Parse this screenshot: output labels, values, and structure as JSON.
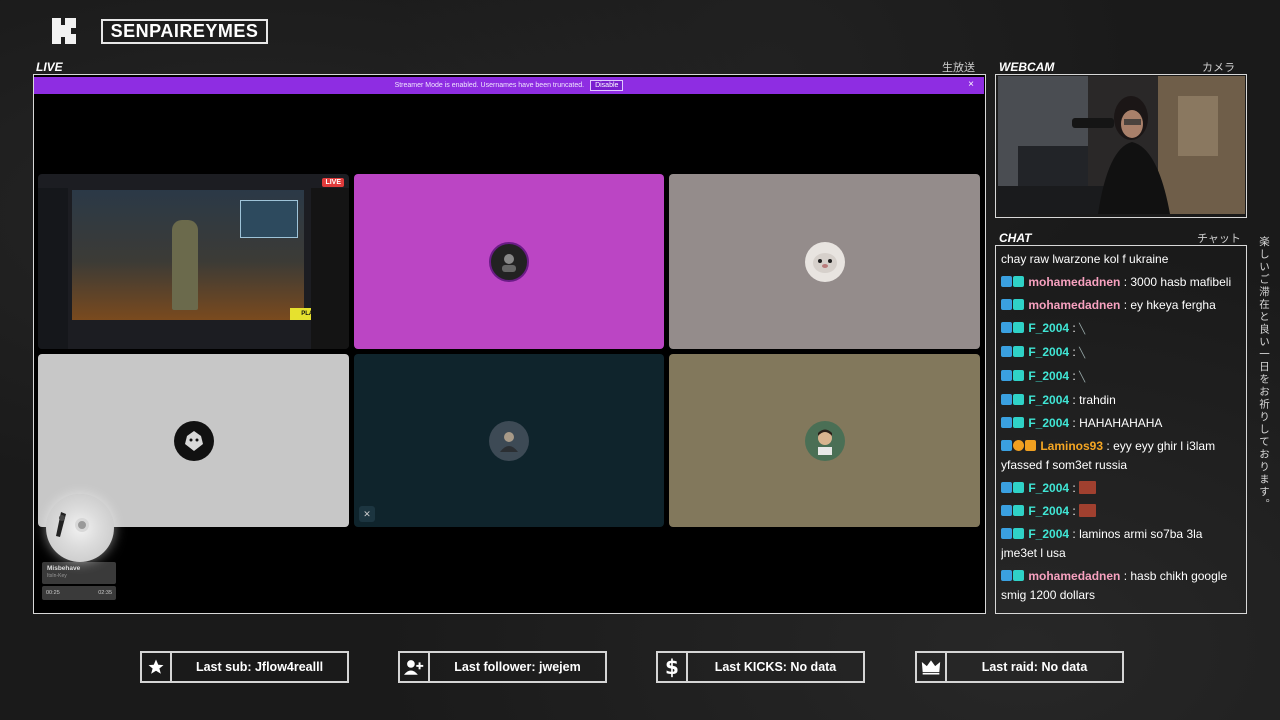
{
  "channel": {
    "name": "SENPAIREYMES"
  },
  "live_panel": {
    "title": "LIVE",
    "title_jp": "生放送",
    "banner_text": "Streamer Mode is enabled. Usernames have been truncated.",
    "banner_button": "Disable",
    "banner_close": "×",
    "live_badge": "LIVE",
    "play_label": "PLAY",
    "tiles": [
      {
        "kind": "screen-share",
        "color": "#1c1d22"
      },
      {
        "kind": "participant",
        "color": "#bb45c4"
      },
      {
        "kind": "participant",
        "color": "#948c8b"
      },
      {
        "kind": "participant",
        "color": "#c7c7c7"
      },
      {
        "kind": "participant",
        "color": "#0f242c"
      },
      {
        "kind": "participant",
        "color": "#82785c"
      }
    ]
  },
  "music_player": {
    "track": "Misbehave",
    "artist": "ItsIn-Key",
    "elapsed": "00:25",
    "duration": "02:35"
  },
  "webcam_panel": {
    "title": "WEBCAM",
    "title_jp": "カメラ"
  },
  "chat_panel": {
    "title": "CHAT",
    "title_jp": "チャット",
    "messages": [
      {
        "user": "",
        "text": "chay raw lwarzone kol f ukraine",
        "color": "#ffffff"
      },
      {
        "user": "mohamedadnen",
        "text": "3000 hasb mafibeli",
        "color": "#f7a1bf"
      },
      {
        "user": "mohamedadnen",
        "text": "ey hkeya fergha",
        "color": "#f7a1bf"
      },
      {
        "user": "F_2004",
        "text": "",
        "color": "#40e6d5"
      },
      {
        "user": "F_2004",
        "text": "",
        "color": "#40e6d5"
      },
      {
        "user": "F_2004",
        "text": "",
        "color": "#40e6d5"
      },
      {
        "user": "F_2004",
        "text": "trahdin",
        "color": "#40e6d5"
      },
      {
        "user": "F_2004",
        "text": "HAHAHAHAHA",
        "color": "#40e6d5"
      },
      {
        "user": "Laminos93",
        "text": "eyy eyy ghir l i3lam yfassed f som3et russia",
        "color": "#f5a623"
      },
      {
        "user": "F_2004",
        "text": "",
        "color": "#40e6d5"
      },
      {
        "user": "F_2004",
        "text": "",
        "color": "#40e6d5"
      },
      {
        "user": "F_2004",
        "text": "laminos armi so7ba 3la jme3et l usa",
        "color": "#40e6d5"
      },
      {
        "user": "mohamedadnen",
        "text": "hasb chikh google smig 1200 dollars",
        "color": "#f7a1bf"
      }
    ]
  },
  "side_text_jp": "楽しいご滞在と良い一日をお祈りしております。",
  "stats": {
    "last_sub": "Last sub: Jflow4realll",
    "last_follower": "Last follower: jwejem",
    "last_kicks": "Last KICKS: No data",
    "last_raid": "Last raid: No data"
  }
}
